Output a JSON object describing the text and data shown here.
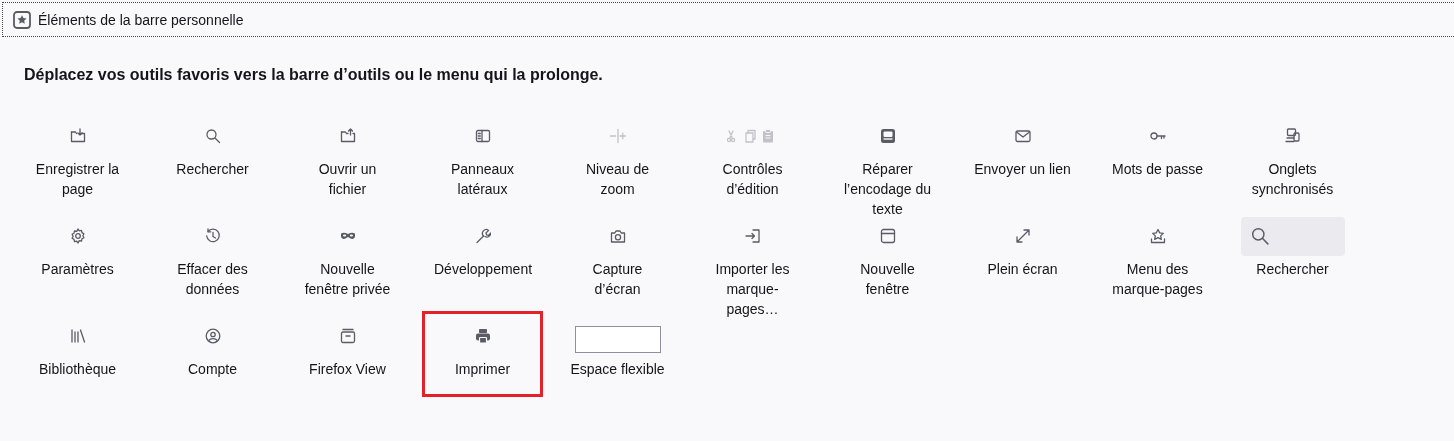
{
  "bar": {
    "title": "Éléments de la barre personnelle"
  },
  "heading": "Déplacez vos outils favoris vers la barre d’outils ou le menu qui la prolonge.",
  "items": [
    {
      "kind": "button",
      "label": "Enregistrer la page",
      "disabled": false,
      "highlighted": false
    },
    {
      "kind": "button",
      "label": "Rechercher",
      "disabled": false,
      "highlighted": false
    },
    {
      "kind": "button",
      "label": "Ouvrir un fichier",
      "disabled": false,
      "highlighted": false
    },
    {
      "kind": "button",
      "label": "Panneaux latéraux",
      "disabled": false,
      "highlighted": false
    },
    {
      "kind": "button",
      "label": "Niveau de zoom",
      "disabled": true,
      "highlighted": false
    },
    {
      "kind": "button",
      "label": "Contrôles d’édition",
      "disabled": true,
      "highlighted": false
    },
    {
      "kind": "button",
      "label": "Réparer l’encodage du texte",
      "disabled": false,
      "highlighted": false
    },
    {
      "kind": "button",
      "label": "Envoyer un lien",
      "disabled": false,
      "highlighted": false
    },
    {
      "kind": "button",
      "label": "Mots de passe",
      "disabled": false,
      "highlighted": false
    },
    {
      "kind": "button",
      "label": "Onglets synchronisés",
      "disabled": false,
      "highlighted": false
    },
    {
      "kind": "button",
      "label": "Paramètres",
      "disabled": false,
      "highlighted": false
    },
    {
      "kind": "button",
      "label": "Effacer des données",
      "disabled": false,
      "highlighted": false
    },
    {
      "kind": "button",
      "label": "Nouvelle fenêtre privée",
      "disabled": false,
      "highlighted": false
    },
    {
      "kind": "button",
      "label": "Développement",
      "disabled": false,
      "highlighted": false
    },
    {
      "kind": "button",
      "label": "Capture d’écran",
      "disabled": false,
      "highlighted": false
    },
    {
      "kind": "button",
      "label": "Importer les marque-pages…",
      "disabled": false,
      "highlighted": false
    },
    {
      "kind": "button",
      "label": "Nouvelle fenêtre",
      "disabled": false,
      "highlighted": false
    },
    {
      "kind": "button",
      "label": "Plein écran",
      "disabled": false,
      "highlighted": false
    },
    {
      "kind": "button",
      "label": "Menu des marque-pages",
      "disabled": false,
      "highlighted": false
    },
    {
      "kind": "search",
      "label": "Rechercher",
      "highlighted": false
    },
    {
      "kind": "button",
      "label": "Bibliothèque",
      "disabled": false,
      "highlighted": false
    },
    {
      "kind": "button",
      "label": "Compte",
      "disabled": false,
      "highlighted": false
    },
    {
      "kind": "button",
      "label": "Firefox View",
      "disabled": false,
      "highlighted": false
    },
    {
      "kind": "button",
      "label": "Imprimer",
      "disabled": false,
      "highlighted": true
    },
    {
      "kind": "spacer",
      "label": "Espace flexible",
      "highlighted": false
    }
  ]
}
